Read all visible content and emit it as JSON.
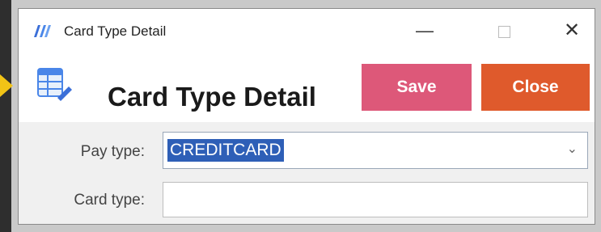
{
  "window": {
    "title": "Card Type Detail",
    "controls": {
      "minimize": "—",
      "close": "✕"
    }
  },
  "header": {
    "title": "Card Type Detail",
    "save_label": "Save",
    "close_label": "Close"
  },
  "form": {
    "pay_type": {
      "label": "Pay type:",
      "value": "CREDITCARD"
    },
    "card_type": {
      "label": "Card type:",
      "value": ""
    }
  },
  "colors": {
    "save": "#dd5879",
    "close": "#df5a2c",
    "selection": "#2e5fb7"
  }
}
